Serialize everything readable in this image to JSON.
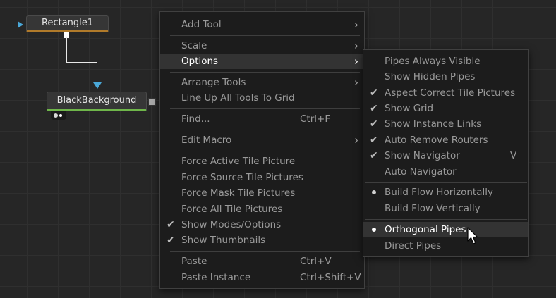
{
  "nodes": {
    "rectangle": {
      "label": "Rectangle1",
      "accent": "#b07a2a"
    },
    "black_background": {
      "label": "BlackBackground",
      "accent": "#6fb64a"
    }
  },
  "context_menu": {
    "items": [
      {
        "label": "Add Tool",
        "submenu": true
      },
      {
        "label": "Scale",
        "submenu": true
      },
      {
        "label": "Options",
        "submenu": true,
        "highlighted": true
      },
      {
        "label": "Arrange Tools",
        "submenu": true
      },
      {
        "label": "Line Up All Tools To Grid"
      },
      {
        "label": "Find...",
        "shortcut": "Ctrl+F"
      },
      {
        "label": "Edit Macro",
        "submenu": true
      },
      {
        "label": "Force Active Tile Picture"
      },
      {
        "label": "Force Source Tile Pictures"
      },
      {
        "label": "Force Mask Tile Pictures"
      },
      {
        "label": "Force All Tile Pictures"
      },
      {
        "label": "Show Modes/Options",
        "checked": true
      },
      {
        "label": "Show Thumbnails",
        "checked": true
      },
      {
        "label": "Paste",
        "shortcut": "Ctrl+V"
      },
      {
        "label": "Paste Instance",
        "shortcut": "Ctrl+Shift+V"
      }
    ]
  },
  "options_submenu": {
    "items": [
      {
        "label": "Pipes Always Visible"
      },
      {
        "label": "Show Hidden Pipes"
      },
      {
        "label": "Aspect Correct Tile Pictures",
        "checked": true
      },
      {
        "label": "Show Grid",
        "checked": true
      },
      {
        "label": "Show Instance Links",
        "checked": true
      },
      {
        "label": "Auto Remove Routers",
        "checked": true
      },
      {
        "label": "Show Navigator",
        "checked": true,
        "shortcut": "V"
      },
      {
        "label": "Auto Navigator"
      },
      {
        "label": "Build Flow Horizontally",
        "radio": true
      },
      {
        "label": "Build Flow Vertically"
      },
      {
        "label": "Orthogonal Pipes",
        "radio": true,
        "highlighted": true
      },
      {
        "label": "Direct Pipes"
      }
    ]
  },
  "glyphs": {
    "check": "✔",
    "submenu_arrow": "›"
  },
  "colors": {
    "highlight": "#333333",
    "pipe_arrow": "#4aa8d8"
  }
}
